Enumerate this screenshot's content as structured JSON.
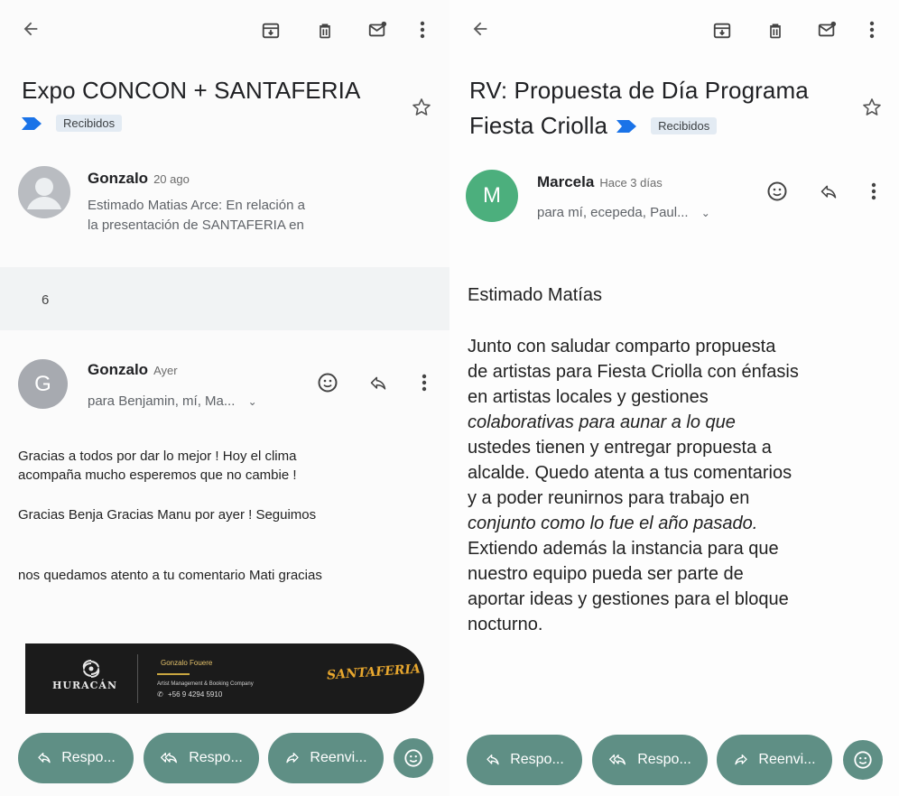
{
  "left": {
    "subject": "Expo CONCON + SANTAFERIA",
    "label": "Recibidos",
    "first_message": {
      "sender": "Gonzalo",
      "time": "20 ago",
      "snippet_line1": "Estimado Matias Arce: En relación a",
      "snippet_line2": "la presentación de SANTAFERIA en"
    },
    "collapsed_count": "6",
    "message": {
      "avatar_letter": "G",
      "avatar_color": "#a7aab0",
      "sender": "Gonzalo",
      "time": "Ayer",
      "recipients": "para Benjamin, mí, Ma...",
      "body_line1": "Gracias a todos por dar lo mejor ! Hoy el clima",
      "body_line2": "acompaña mucho esperemos que no cambie !",
      "body_line3": "Gracias Benja Gracias Manu por ayer ! Seguimos",
      "body_line4": "nos quedamos atento a tu comentario Mati gracias"
    },
    "signature": {
      "brand": "HURACÁN",
      "name": "Gonzalo Fouere",
      "role": "Artist Management & Booking Company",
      "phone": "+56 9 4294 5910",
      "partner": "SANTAFERIA"
    },
    "actions": {
      "reply": "Respo...",
      "reply_all": "Respo...",
      "forward": "Reenvi..."
    }
  },
  "right": {
    "subject_line1": "RV: Propuesta de Día Programa",
    "subject_line2": "Fiesta Criolla",
    "label": "Recibidos",
    "message": {
      "avatar_letter": "M",
      "avatar_color": "#4caf7d",
      "sender": "Marcela",
      "time": "Hace 3 días",
      "recipients": "para mí, ecepeda, Paul...",
      "greeting": "Estimado Matías",
      "body_lines": [
        "Junto con saludar comparto propuesta",
        "de artistas para Fiesta Criolla con énfasis",
        "en artistas locales y gestiones",
        "colaborativas para aunar a lo que",
        "ustedes tienen y entregar propuesta a",
        "alcalde. Quedo atenta a tus comentarios",
        "y a poder reunirnos para trabajo en",
        "conjunto como lo fue el año pasado.",
        "Extiendo además la instancia para que",
        "nuestro equipo pueda ser parte de",
        "aportar ideas y gestiones para el bloque",
        "nocturno."
      ]
    },
    "actions": {
      "reply": "Respo...",
      "reply_all": "Respo...",
      "forward": "Reenvi..."
    }
  },
  "colors": {
    "accent_pill": "#5f8f85",
    "label_chip": "#e3ebf3",
    "importance_marker": "#1a73e8"
  },
  "icons": [
    "back-arrow-icon",
    "archive-icon",
    "delete-icon",
    "mark-unread-icon",
    "more-vert-icon",
    "star-icon",
    "importance-marker-icon",
    "emoji-icon",
    "reply-icon",
    "reply-all-icon",
    "forward-icon",
    "chevron-down-icon",
    "person-icon",
    "whatsapp-icon"
  ]
}
